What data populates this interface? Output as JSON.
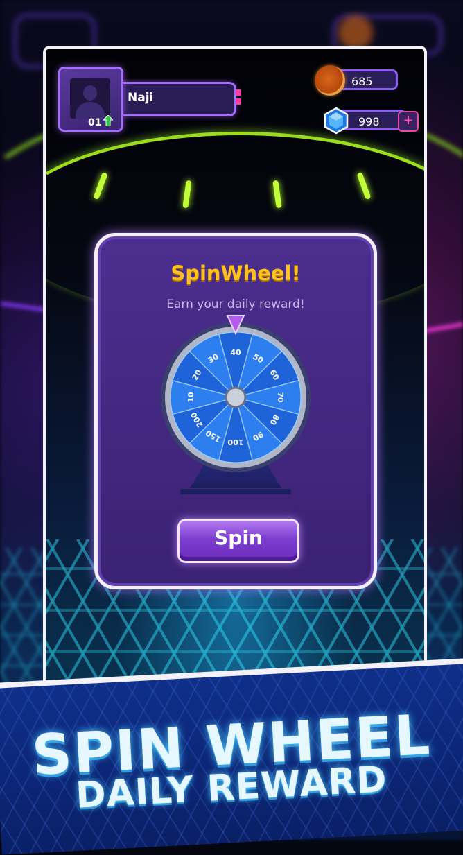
{
  "player": {
    "name": "Naji",
    "level": "01"
  },
  "currency": {
    "coins": "685",
    "gems": "998",
    "add_label": "+"
  },
  "modal": {
    "title": "SpinWheel!",
    "subtitle": "Earn your daily reward!",
    "spin_label": "Spin"
  },
  "wheel": {
    "segments": [
      "40",
      "50",
      "60",
      "70",
      "80",
      "90",
      "100",
      "150",
      "200",
      "10",
      "20",
      "30"
    ]
  },
  "banner": {
    "title": "SPIN WHEEL",
    "subtitle": "DAILY REWARD"
  },
  "colors": {
    "accent": "#a56cff",
    "title": "#ffc21c",
    "coin": "#d8661a",
    "gem": "#3aa0ff",
    "wheel": "#1e6fe0"
  },
  "icons": {
    "coin": "coin-icon",
    "gem": "gem-icon",
    "avatar": "avatar-icon",
    "level_up": "arrow-up-icon",
    "pointer": "triangle-pointer-icon"
  }
}
